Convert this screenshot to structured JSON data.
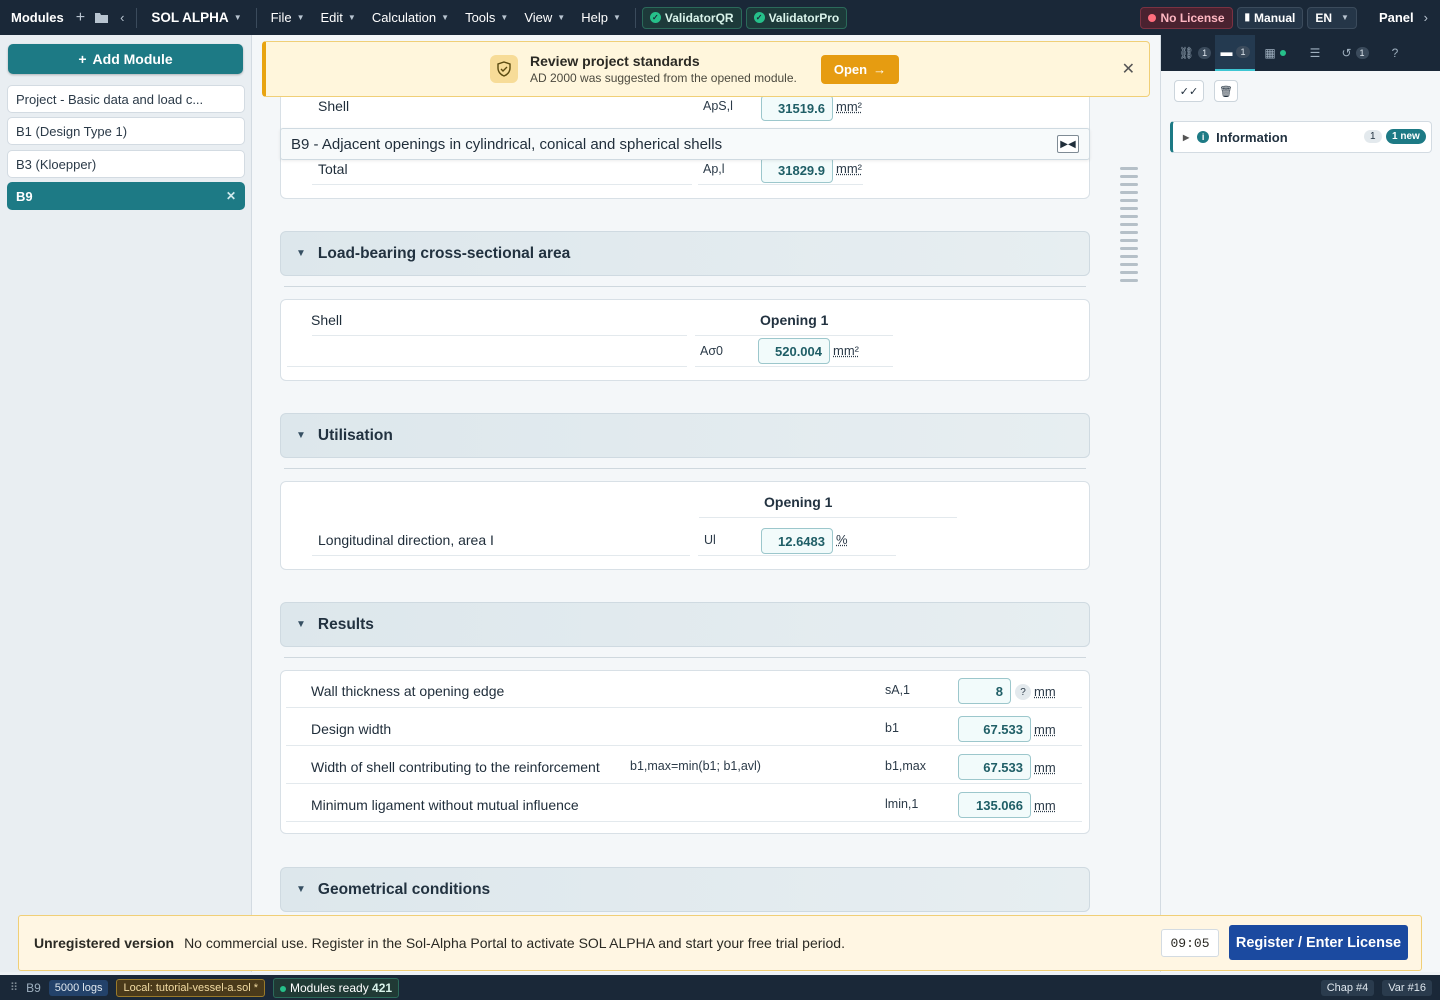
{
  "menubar": {
    "modules": "Modules",
    "app_title": "SOL ALPHA",
    "menus": [
      "File",
      "Edit",
      "Calculation",
      "Tools",
      "View",
      "Help"
    ],
    "validators": [
      "ValidatorQR",
      "ValidatorPro"
    ],
    "license": "No License",
    "manual": "Manual",
    "lang": "EN",
    "panel": "Panel"
  },
  "sidebar": {
    "add_module": "Add Module",
    "items": [
      "Project - Basic data and load c...",
      "B1 (Design Type 1)",
      "B3 (Kloepper)",
      "B9"
    ]
  },
  "banner": {
    "title": "Review project standards",
    "text": "AD 2000 was suggested from the opened module.",
    "open": "Open"
  },
  "module_title": "B9 - Adjacent openings in cylindrical, conical and spherical shells",
  "top_card": {
    "shell_label": "Shell",
    "shell_sym": "ApS,l",
    "shell_val": "31519.6",
    "shell_unit": "mm²",
    "total_label": "Total",
    "total_sym": "Ap,l",
    "total_val": "31829.9",
    "total_unit": "mm²"
  },
  "load_bearing": {
    "title": "Load-bearing cross-sectional area",
    "shell": "Shell",
    "col": "Opening 1",
    "sym": "Aσ0",
    "val": "520.004",
    "unit": "mm²"
  },
  "utilisation": {
    "title": "Utilisation",
    "col": "Opening 1",
    "label": "Longitudinal direction, area I",
    "sym": "Ul",
    "val": "12.6483",
    "unit": "%"
  },
  "results": {
    "title": "Results",
    "rows": [
      {
        "label": "Wall thickness at opening edge",
        "formula": "",
        "sym": "sA,1",
        "val": "8",
        "unit": "mm",
        "help": "?"
      },
      {
        "label": "Design width",
        "formula": "",
        "sym": "b1",
        "val": "67.533",
        "unit": "mm"
      },
      {
        "label": "Width of shell contributing to the reinforcement",
        "formula": "b1,max=min(b1; b1,avl)",
        "sym": "b1,max",
        "val": "67.533",
        "unit": "mm"
      },
      {
        "label": "Minimum ligament without mutual influence",
        "formula": "",
        "sym": "lmin,1",
        "val": "135.066",
        "unit": "mm"
      }
    ]
  },
  "geometrical": {
    "title": "Geometrical conditions"
  },
  "right_panel": {
    "tabs": [
      {
        "count": "1"
      },
      {
        "count": "1"
      },
      {
        "count": ""
      },
      {
        "count": ""
      },
      {
        "count": "1"
      }
    ],
    "info_label": "Information",
    "info_count": "1",
    "info_new": "1 new"
  },
  "unregistered": {
    "title": "Unregistered version",
    "text": "No commercial use. Register in the Sol-Alpha Portal to activate SOL ALPHA and start your free trial period.",
    "timer": "09:05",
    "button": "Register / Enter License"
  },
  "statusbar": {
    "module": "B9",
    "logs": "5000 logs",
    "local": "Local: tutorial-vessel-a.sol *",
    "ready": "Modules ready",
    "ready_count": "421",
    "chap": "Chap #4",
    "var": "Var #16"
  }
}
